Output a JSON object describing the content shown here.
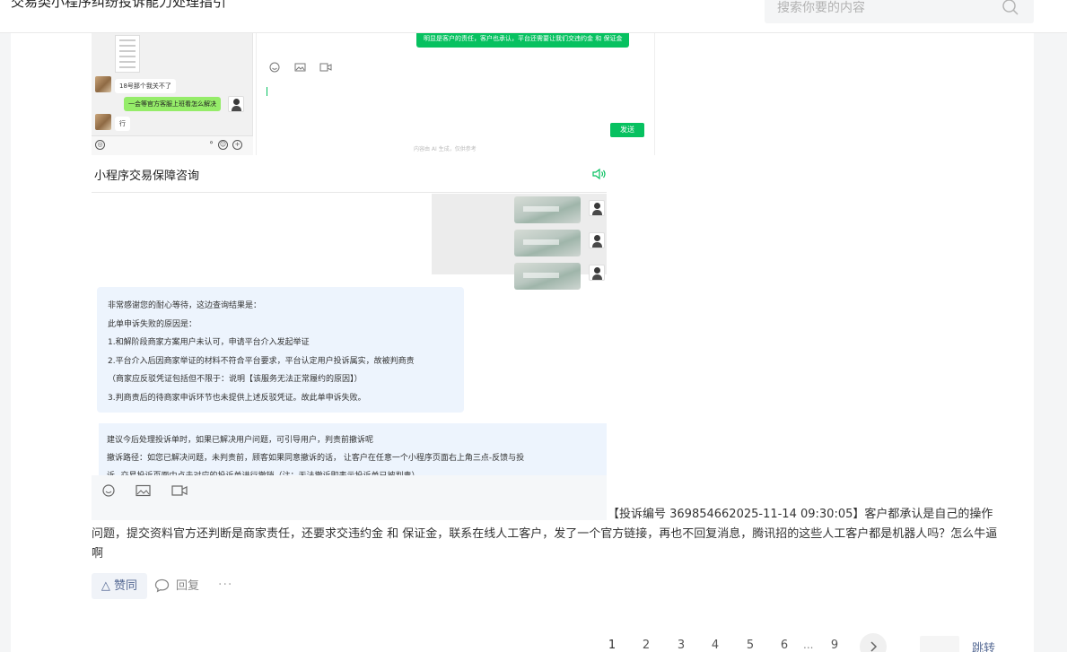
{
  "header": {
    "title": "交易类小程序纠纷投诉能力处理指引",
    "search_placeholder": "搜索你要的内容"
  },
  "screenshot_chat": {
    "left_messages": [
      "18号那个我关不了",
      "一会等官方客服上班看怎么解决",
      "行"
    ],
    "right_bubble": "明显是客户的责任，客户也承认，平台还需要让我们交违约金 和 保证金",
    "send_label": "发送",
    "ai_note": "内容由 AI 生成，仅供参考"
  },
  "screenshot_consult": {
    "title": "小程序交易保障咨询",
    "reply_lines": [
      "非常感谢您的耐心等待，这边查询结果是：",
      "此单申诉失败的原因是：",
      "1.和解阶段商家方案用户未认可，申请平台介入发起举证",
      "2.平台介入后因商家举证的材料不符合平台要求，平台认定用户投诉属实，故被判商责",
      "（商家应反驳凭证包括但不限于：说明【该服务无法正常履约的原因】）",
      "3.判商责后的待商家申诉环节也未提供上述反驳凭证。故此单申诉失败。"
    ],
    "suggest_lines": [
      "建议今后处理投诉单时，如果已解决用户问题，可引导用户，判责前撤诉呢",
      "撤诉路径：如您已解决问题，未判责前，顾客如果同意撤诉的话， 让客户在任意一个小程序页面右上角三点-反馈与投",
      "诉--交易投诉页面中点击对应的投诉单进行撤销（注：无法撤诉即表示投诉单已被判责）"
    ]
  },
  "comment": {
    "text": "【投诉编号 369854662025-11-14 09:30:05】客户都承认是自己的操作问题，提交资料官方还判断是商家责任，还要求交违约金 和 保证金，联系在线人工客户，发了一个官方链接，再也不回复消息，腾讯招的这些人工客户都是机器人吗？怎么牛逼啊"
  },
  "actions": {
    "like_label": "△ 赞同",
    "reply_label": "回复",
    "more_label": "···"
  },
  "pagination": {
    "pages": [
      "1",
      "2",
      "3",
      "4",
      "5",
      "6",
      "9"
    ],
    "ellipsis": "...",
    "jump_label": "跳转"
  },
  "colors": {
    "wechat_green": "#07c160",
    "link_blue": "#576b95",
    "reply_bg": "#edf4fd"
  }
}
